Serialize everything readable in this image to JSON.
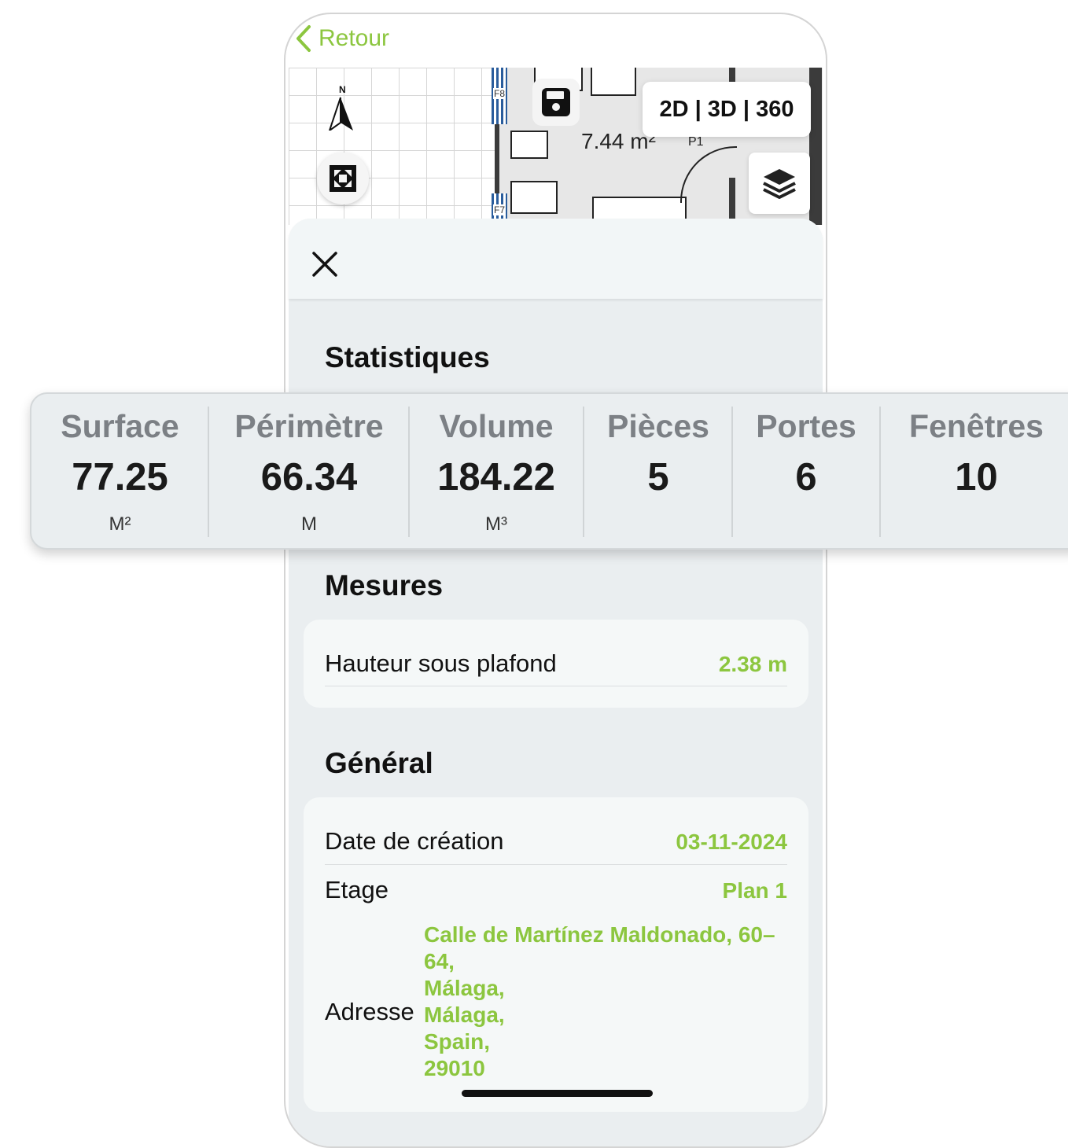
{
  "nav": {
    "back_label": "Retour"
  },
  "map": {
    "area_label": "7.44 m²",
    "door_label": "P1",
    "window_labels": [
      "F8",
      "F7"
    ],
    "compass_label": "N",
    "view_modes": "2D | 3D | 360"
  },
  "sheet": {
    "statistics_title": "Statistiques",
    "measures_title": "Mesures",
    "general_title": "Général"
  },
  "stats": [
    {
      "label": "Surface",
      "value": "77.25",
      "unit": "M²"
    },
    {
      "label": "Périmètre",
      "value": "66.34",
      "unit": "M"
    },
    {
      "label": "Volume",
      "value": "184.22",
      "unit": "M³"
    },
    {
      "label": "Pièces",
      "value": "5",
      "unit": ""
    },
    {
      "label": "Portes",
      "value": "6",
      "unit": ""
    },
    {
      "label": "Fenêtres",
      "value": "10",
      "unit": ""
    }
  ],
  "measures": {
    "ceiling_height_label": "Hauteur sous plafond",
    "ceiling_height_value": "2.38 m"
  },
  "general": {
    "creation_date_label": "Date de création",
    "creation_date_value": "03-11-2024",
    "floor_label": "Etage",
    "floor_value": "Plan 1",
    "address_label": "Adresse",
    "address_lines": [
      "Calle de Martínez Maldonado, 60–",
      "64,",
      "Málaga,",
      "Málaga,",
      "Spain,",
      "29010"
    ]
  },
  "colors": {
    "accent": "#8cc63f",
    "sheet_bg": "#eaeef0",
    "card_bg": "#f5f8f8"
  }
}
